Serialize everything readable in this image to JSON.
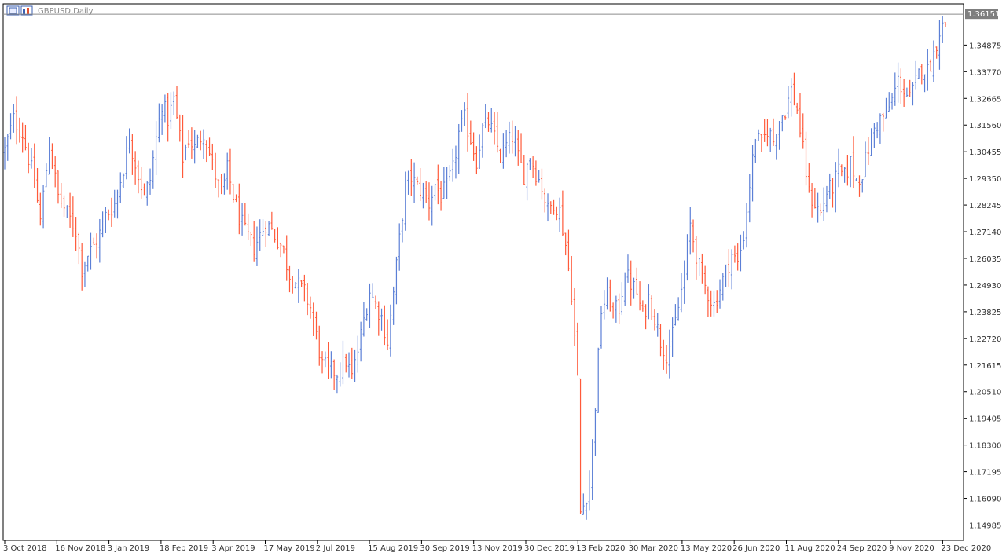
{
  "window": {
    "title": "GBPUSD,Daily",
    "icons": [
      "window-restore-icon",
      "symbol-chart-icon"
    ]
  },
  "colors": {
    "background": "#ffffff",
    "frame": "#000000",
    "bull_bar": "#5b7fd6",
    "bear_bar": "#ff5a3a",
    "price_tag_bg": "#7f7f7f",
    "price_line": "#8c8c8c"
  },
  "chart_data": {
    "type": "bar",
    "symbol": "GBPUSD",
    "timeframe": "Daily",
    "ylim": [
      1.1435,
      1.3658
    ],
    "yticks": [
      "1.34875",
      "1.33770",
      "1.32665",
      "1.31560",
      "1.30455",
      "1.29350",
      "1.28245",
      "1.27140",
      "1.26035",
      "1.24930",
      "1.23825",
      "1.22720",
      "1.21615",
      "1.20510",
      "1.19405",
      "1.18300",
      "1.17195",
      "1.16090",
      "1.14985"
    ],
    "last_price": "1.36151",
    "xtick_labels": [
      "3 Oct 2018",
      "16 Nov 2018",
      "3 Jan 2019",
      "18 Feb 2019",
      "3 Apr 2019",
      "17 May 2019",
      "2 Jul 2019",
      "15 Aug 2019",
      "30 Sep 2019",
      "13 Nov 2019",
      "30 Dec 2019",
      "13 Feb 2020",
      "30 Mar 2020",
      "13 May 2020",
      "26 Jun 2020",
      "11 Aug 2020",
      "24 Sep 2020",
      "9 Nov 2020",
      "23 Dec 2020"
    ],
    "close_path": [
      [
        0,
        1.305
      ],
      [
        3,
        1.318
      ],
      [
        6,
        1.312
      ],
      [
        10,
        1.292
      ],
      [
        12,
        1.276
      ],
      [
        15,
        1.308
      ],
      [
        18,
        1.286
      ],
      [
        21,
        1.279
      ],
      [
        24,
        1.272
      ],
      [
        26,
        1.256
      ],
      [
        28,
        1.262
      ],
      [
        31,
        1.267
      ],
      [
        34,
        1.278
      ],
      [
        37,
        1.283
      ],
      [
        40,
        1.298
      ],
      [
        42,
        1.31
      ],
      [
        45,
        1.295
      ],
      [
        47,
        1.286
      ],
      [
        49,
        1.293
      ],
      [
        51,
        1.31
      ],
      [
        53,
        1.325
      ],
      [
        55,
        1.318
      ],
      [
        57,
        1.326
      ],
      [
        60,
        1.302
      ],
      [
        62,
        1.31
      ],
      [
        64,
        1.306
      ],
      [
        67,
        1.313
      ],
      [
        70,
        1.299
      ],
      [
        73,
        1.286
      ],
      [
        75,
        1.297
      ],
      [
        78,
        1.281
      ],
      [
        81,
        1.271
      ],
      [
        84,
        1.265
      ],
      [
        86,
        1.27
      ],
      [
        88,
        1.275
      ],
      [
        90,
        1.272
      ],
      [
        93,
        1.266
      ],
      [
        96,
        1.254
      ],
      [
        99,
        1.249
      ],
      [
        101,
        1.246
      ],
      [
        103,
        1.24
      ],
      [
        105,
        1.228
      ],
      [
        107,
        1.216
      ],
      [
        110,
        1.214
      ],
      [
        112,
        1.213
      ],
      [
        115,
        1.218
      ],
      [
        117,
        1.211
      ],
      [
        119,
        1.222
      ],
      [
        121,
        1.235
      ],
      [
        123,
        1.247
      ],
      [
        125,
        1.241
      ],
      [
        127,
        1.236
      ],
      [
        129,
        1.226
      ],
      [
        131,
        1.246
      ],
      [
        133,
        1.268
      ],
      [
        135,
        1.29
      ],
      [
        137,
        1.294
      ],
      [
        139,
        1.29
      ],
      [
        141,
        1.288
      ],
      [
        143,
        1.283
      ],
      [
        145,
        1.291
      ],
      [
        147,
        1.286
      ],
      [
        149,
        1.29
      ],
      [
        151,
        1.297
      ],
      [
        153,
        1.312
      ],
      [
        155,
        1.318
      ],
      [
        157,
        1.31
      ],
      [
        159,
        1.301
      ],
      [
        161,
        1.314
      ],
      [
        163,
        1.317
      ],
      [
        165,
        1.31
      ],
      [
        167,
        1.303
      ],
      [
        169,
        1.307
      ],
      [
        171,
        1.311
      ],
      [
        173,
        1.302
      ],
      [
        175,
        1.295
      ],
      [
        177,
        1.303
      ],
      [
        179,
        1.296
      ],
      [
        181,
        1.29
      ],
      [
        183,
        1.28
      ],
      [
        185,
        1.284
      ],
      [
        187,
        1.28
      ],
      [
        189,
        1.266
      ],
      [
        191,
        1.246
      ],
      [
        193,
        1.21
      ],
      [
        194,
        1.155
      ],
      [
        195,
        1.158
      ],
      [
        197,
        1.167
      ],
      [
        199,
        1.2
      ],
      [
        201,
        1.239
      ],
      [
        203,
        1.245
      ],
      [
        205,
        1.238
      ],
      [
        207,
        1.24
      ],
      [
        209,
        1.254
      ],
      [
        211,
        1.25
      ],
      [
        213,
        1.246
      ],
      [
        215,
        1.236
      ],
      [
        217,
        1.244
      ],
      [
        219,
        1.236
      ],
      [
        221,
        1.226
      ],
      [
        223,
        1.221
      ],
      [
        225,
        1.228
      ],
      [
        227,
        1.24
      ],
      [
        229,
        1.254
      ],
      [
        231,
        1.274
      ],
      [
        233,
        1.262
      ],
      [
        235,
        1.251
      ],
      [
        237,
        1.246
      ],
      [
        239,
        1.241
      ],
      [
        241,
        1.248
      ],
      [
        243,
        1.255
      ],
      [
        245,
        1.262
      ],
      [
        247,
        1.258
      ],
      [
        249,
        1.27
      ],
      [
        251,
        1.291
      ],
      [
        253,
        1.311
      ],
      [
        255,
        1.307
      ],
      [
        257,
        1.314
      ],
      [
        259,
        1.309
      ],
      [
        261,
        1.318
      ],
      [
        263,
        1.322
      ],
      [
        265,
        1.33
      ],
      [
        267,
        1.322
      ],
      [
        269,
        1.305
      ],
      [
        271,
        1.287
      ],
      [
        273,
        1.283
      ],
      [
        275,
        1.279
      ],
      [
        277,
        1.288
      ],
      [
        279,
        1.29
      ],
      [
        281,
        1.296
      ],
      [
        283,
        1.294
      ],
      [
        285,
        1.3
      ],
      [
        287,
        1.293
      ],
      [
        289,
        1.296
      ],
      [
        291,
        1.306
      ],
      [
        293,
        1.314
      ],
      [
        295,
        1.318
      ],
      [
        297,
        1.32
      ],
      [
        299,
        1.326
      ],
      [
        301,
        1.334
      ],
      [
        303,
        1.33
      ],
      [
        305,
        1.326
      ],
      [
        307,
        1.333
      ],
      [
        309,
        1.34
      ],
      [
        311,
        1.338
      ],
      [
        313,
        1.345
      ],
      [
        315,
        1.355
      ],
      [
        317,
        1.358
      ]
    ]
  }
}
